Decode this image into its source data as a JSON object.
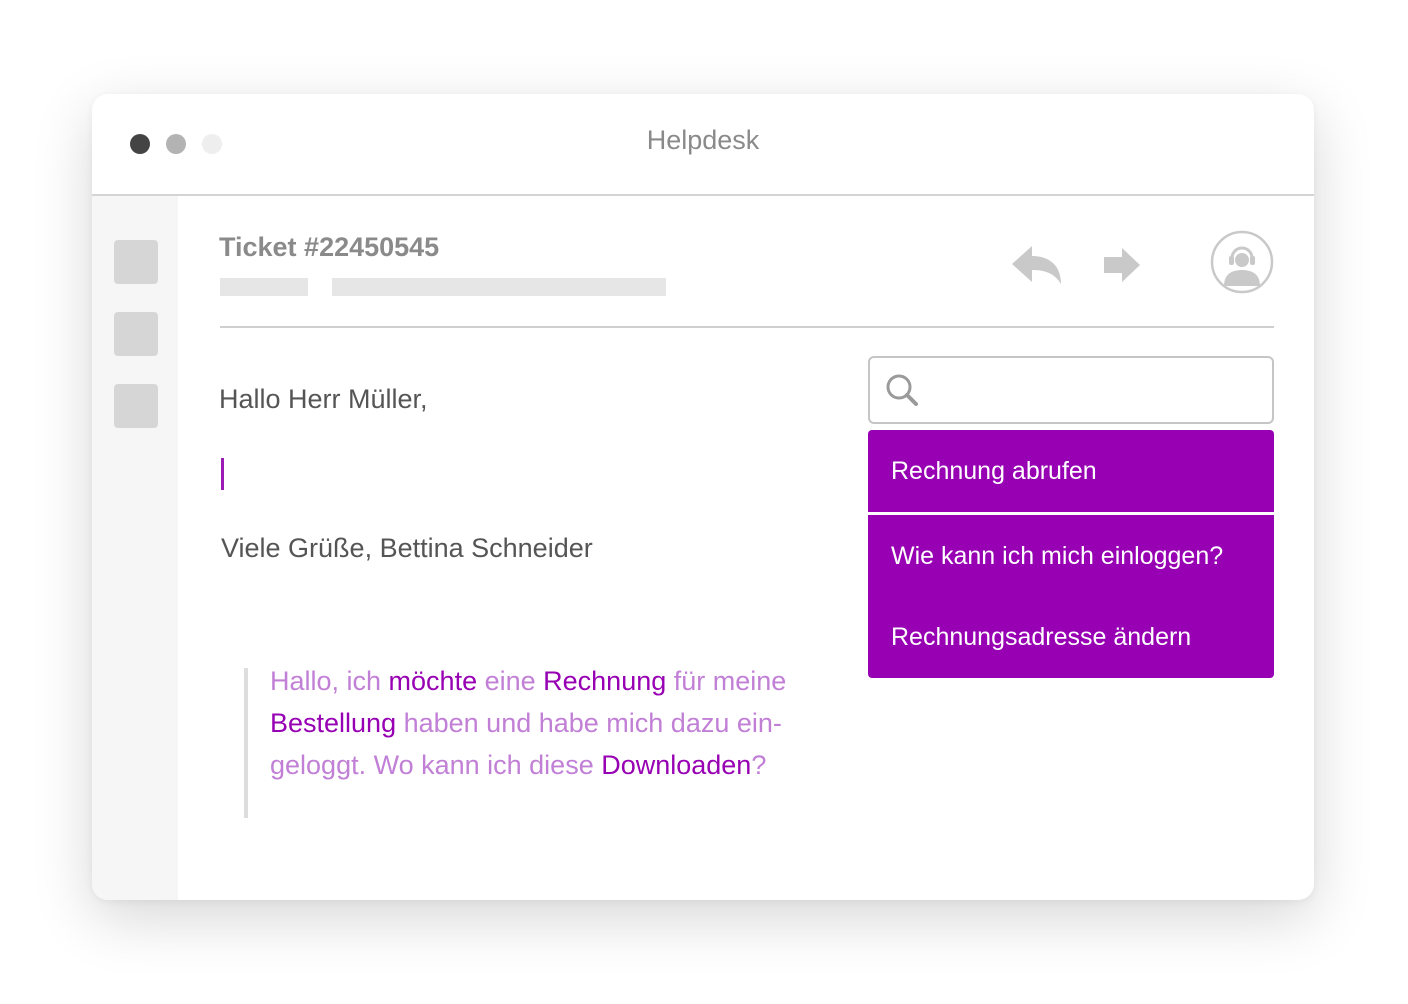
{
  "window": {
    "title": "Helpdesk"
  },
  "ticket": {
    "title": "Ticket #22450545"
  },
  "reply": {
    "greeting": "Hallo Herr Müller,",
    "signature": "Viele Grüße, Bettina Schneider"
  },
  "quote": {
    "lines": [
      [
        {
          "text": "Hallo, ich ",
          "hl": false
        },
        {
          "text": "möchte",
          "hl": true
        },
        {
          "text": " eine ",
          "hl": false
        },
        {
          "text": "Rechnung",
          "hl": true
        },
        {
          "text": " für meine",
          "hl": false
        }
      ],
      [
        {
          "text": "Bestellung",
          "hl": true
        },
        {
          "text": " haben und habe mich dazu ein-",
          "hl": false
        }
      ],
      [
        {
          "text": "geloggt. Wo kann ich diese ",
          "hl": false
        },
        {
          "text": "Downloaden",
          "hl": true
        },
        {
          "text": "?",
          "hl": false
        }
      ]
    ]
  },
  "search": {
    "placeholder": "",
    "value": ""
  },
  "suggestions": [
    {
      "label": "Rechnung abrufen"
    },
    {
      "label": "Wie kann ich mich einloggen?"
    },
    {
      "label": "Rechnungsadresse ändern"
    }
  ],
  "icons": {
    "reply": "reply-arrow-icon",
    "forward": "forward-arrow-icon",
    "agent": "headset-agent-icon",
    "search": "magnifier-icon"
  },
  "colors": {
    "accent": "#9700b3",
    "accent_light": "#c17fd6",
    "text": "#555555",
    "muted": "#8a8a8a"
  }
}
